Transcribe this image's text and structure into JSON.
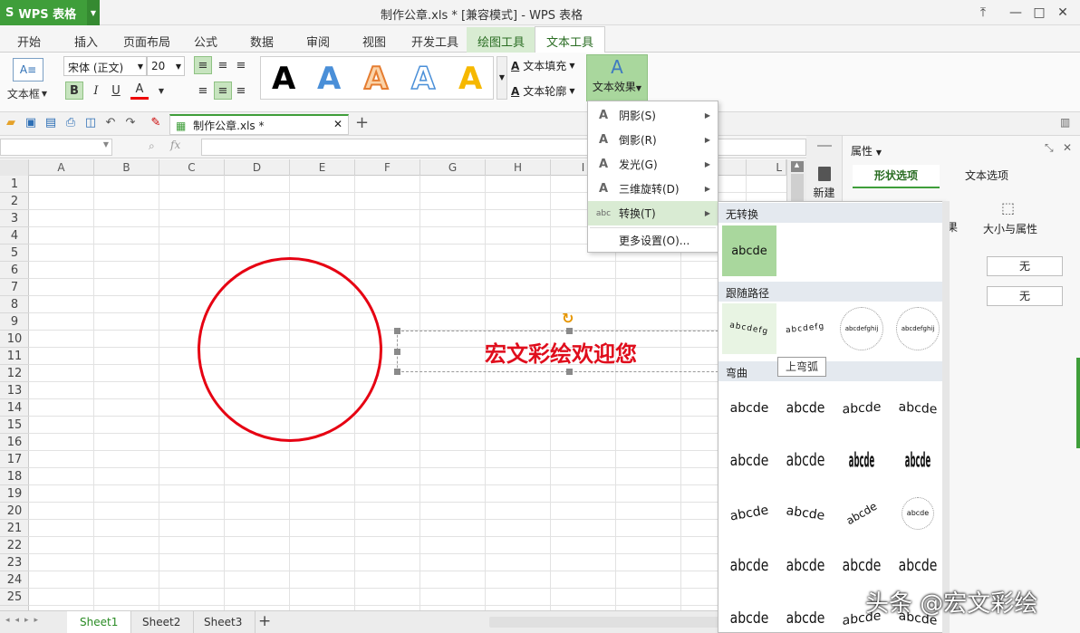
{
  "app": {
    "name": "WPS 表格",
    "logo": "S",
    "doc_title": "制作公章.xls * [兼容模式] - WPS 表格"
  },
  "tabs": [
    "开始",
    "插入",
    "页面布局",
    "公式",
    "数据",
    "审阅",
    "视图",
    "开发工具",
    "绘图工具",
    "文本工具"
  ],
  "ribbon": {
    "textbox_label": "文本框",
    "font_name": "宋体 (正文)",
    "font_size": "20",
    "text_fill": "文本填充",
    "text_outline": "文本轮廓",
    "text_effect": "文本效果",
    "bold": "B",
    "italic": "I",
    "underline": "U",
    "font_color": "A"
  },
  "qabar": {
    "doc_tab": "制作公章.xls *",
    "new_tab": "+"
  },
  "formula": {
    "fx": "fx"
  },
  "grid": {
    "columns": [
      "A",
      "B",
      "C",
      "D",
      "E",
      "F",
      "G",
      "H",
      "I",
      "J",
      "K",
      "L"
    ],
    "rows": [
      "1",
      "2",
      "3",
      "4",
      "5",
      "6",
      "7",
      "8",
      "9",
      "10",
      "11",
      "12",
      "13",
      "14",
      "15",
      "16",
      "17",
      "18",
      "19",
      "20",
      "21",
      "22",
      "23",
      "24",
      "25"
    ]
  },
  "wordart_text": "宏文彩绘欢迎您",
  "sheets": [
    "Sheet1",
    "Sheet2",
    "Sheet3"
  ],
  "pane": {
    "title": "属性",
    "new_label": "新建",
    "tab_shape": "形状选项",
    "tab_text": "文本选项",
    "size_props": "大小与属性",
    "effect_partial": "果",
    "none1": "无",
    "none2": "无"
  },
  "menu": [
    {
      "label": "阴影(S)",
      "icon": "A"
    },
    {
      "label": "倒影(R)",
      "icon": "A"
    },
    {
      "label": "发光(G)",
      "icon": "A"
    },
    {
      "label": "三维旋转(D)",
      "icon": "A"
    },
    {
      "label": "转换(T)",
      "icon": "abc"
    },
    {
      "label": "更多设置(O)..."
    }
  ],
  "submenu": {
    "no_transform": "无转换",
    "follow_path": "跟随路径",
    "warp": "弯曲",
    "sample": "abcde",
    "tooltip": "上弯弧",
    "path_samples": [
      "abcdefg",
      "abcdefg",
      "abcdefghij",
      "abcdefghij"
    ],
    "warp_samples": [
      "abcde",
      "abcde",
      "abcde",
      "abcde",
      "abcde",
      "abcde",
      "abcde",
      "abcde",
      "abcde",
      "abcde",
      "abcde",
      "abcde",
      "abcde",
      "abcde",
      "abcde",
      "abcde",
      "abcde",
      "abcde",
      "abcde",
      "abcde"
    ]
  },
  "watermark": "头条 @宏文彩绘",
  "colors": {
    "accent": "#3f9e3a",
    "seal_red": "#e60012"
  }
}
